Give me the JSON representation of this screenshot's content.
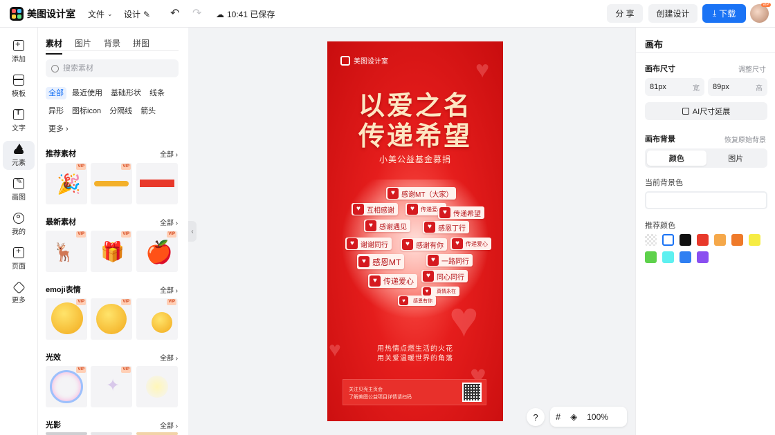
{
  "app": {
    "name": "美图设计室"
  },
  "header": {
    "file_label": "文件",
    "design_label": "设计",
    "save_status": "10:41 已保存",
    "share_label": "分 享",
    "create_label": "创建设计",
    "download_label": "下载",
    "avatar_badge": "VIP"
  },
  "rail": {
    "add": "添加",
    "template": "模板",
    "text": "文字",
    "element": "元素",
    "draw": "画图",
    "mine": "我的",
    "page": "页面",
    "more": "更多"
  },
  "materials": {
    "tabs": [
      "素材",
      "图片",
      "背景",
      "拼图"
    ],
    "search_placeholder": "搜索素材",
    "chips": [
      "全部",
      "最近使用",
      "基础形状",
      "线条",
      "异形",
      "图标icon",
      "分隔线",
      "箭头",
      "更多 ›"
    ],
    "all_label": "全部",
    "vip_badge": "VIP",
    "sections": {
      "recommend": "推荐素材",
      "latest": "最新素材",
      "emoji": "emoji表情",
      "light": "光效",
      "shadow": "光影"
    }
  },
  "poster": {
    "brand": "美图设计室",
    "headline_1": "以爱之名",
    "headline_2": "传递希望",
    "subtitle": "小美公益基金募捐",
    "tags": [
      "感谢MT（大家）",
      "互相感谢",
      "传递爱心",
      "传递希望",
      "感谢遇见",
      "感恩丁行",
      "谢谢同行",
      "感谢有你",
      "传递爱心",
      "感恩MT",
      "一路同行",
      "同心同行",
      "传递爱心",
      "真情永在",
      "感恩有你"
    ],
    "slogan_1": "用热情点燃生活的火花",
    "slogan_2": "用关爱温暖世界的角落",
    "foot_line_1": "关注贝壳主页会",
    "foot_line_2": "了解美图公益项目详情请扫码"
  },
  "controls": {
    "help": "?",
    "zoom": "100%"
  },
  "right_panel": {
    "title": "画布",
    "size_label": "画布尺寸",
    "adjust_size": "调整尺寸",
    "width_value": "81px",
    "width_unit": "宽",
    "height_value": "89px",
    "height_unit": "高",
    "ai_extend": "AI尺寸延展",
    "bg_label": "画布背景",
    "restore_bg": "恢复原始背景",
    "seg_color": "颜色",
    "seg_image": "图片",
    "current_bg": "当前背景色",
    "recommend_colors": "推荐颜色",
    "swatches": [
      "transparent",
      "#ffffff",
      "#111111",
      "#e8392b",
      "#f5a84a",
      "#ef7a2a",
      "#f6ec43",
      "#5ed14b",
      "#5ef0f0",
      "#2f7ff2",
      "#8a4ff0"
    ]
  }
}
